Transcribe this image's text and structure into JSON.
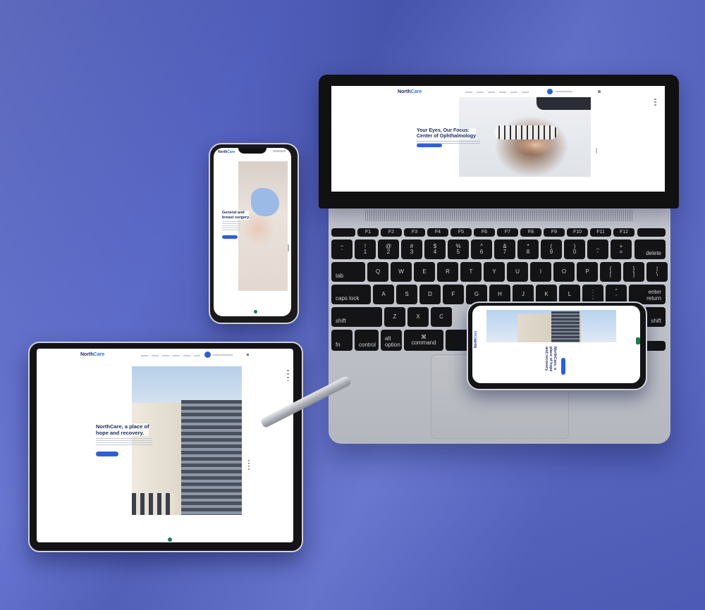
{
  "brand": {
    "name_part1": "North",
    "name_part2": "Care",
    "accent": "#2f5fd0",
    "title_color": "#1b2a5e",
    "background": "#5a68c6"
  },
  "laptop_site": {
    "hero_title_line1": "Your Eyes, Our Focus:",
    "hero_title_line2": "Center of Ophthalmology"
  },
  "phone_site": {
    "hero_title_line1": "General and",
    "hero_title_line2": "breast surgery"
  },
  "tablet_site": {
    "hero_title_line1": "NorthCare, a place of",
    "hero_title_line2": "hope and recovery."
  },
  "landscape_site": {
    "hero_title_line1": "NorthCare, a",
    "hero_title_line2": "place of hope",
    "hero_title_line3": "and recovery."
  },
  "keyboard": {
    "fn_row": [
      "F1",
      "F2",
      "F3",
      "F4",
      "F5",
      "F6",
      "F7",
      "F8",
      "F9",
      "F10",
      "F11",
      "F12"
    ],
    "num_row": [
      [
        "~",
        "`"
      ],
      [
        "!",
        "1"
      ],
      [
        "@",
        "2"
      ],
      [
        "#",
        "3"
      ],
      [
        "$",
        "4"
      ],
      [
        "%",
        "5"
      ],
      [
        "^",
        "6"
      ],
      [
        "&",
        "7"
      ],
      [
        "*",
        "8"
      ],
      [
        "(",
        "9"
      ],
      [
        ")",
        "0"
      ],
      [
        "_",
        "-"
      ],
      [
        "+",
        "="
      ]
    ],
    "delete": "delete",
    "tab": "tab",
    "q_row": [
      "Q",
      "W",
      "E",
      "R",
      "T",
      "Y",
      "U",
      "I",
      "O",
      "P"
    ],
    "q_row_extra": [
      [
        "{",
        "["
      ],
      [
        "}",
        "]"
      ],
      [
        "|",
        "\\"
      ]
    ],
    "caps": "caps lock",
    "a_row": [
      "A",
      "S",
      "D",
      "F",
      "G",
      "H",
      "J",
      "K",
      "L"
    ],
    "a_row_extra": [
      [
        ":",
        ";"
      ],
      [
        "\"",
        "'"
      ]
    ],
    "enter": "enter",
    "return": "return",
    "shift": "shift",
    "z_row": [
      "Z",
      "X",
      "C"
    ],
    "fn": "fn",
    "control": "control",
    "option": "option",
    "alt": "alt",
    "command": "command",
    "cmd_symbol": "⌘"
  }
}
